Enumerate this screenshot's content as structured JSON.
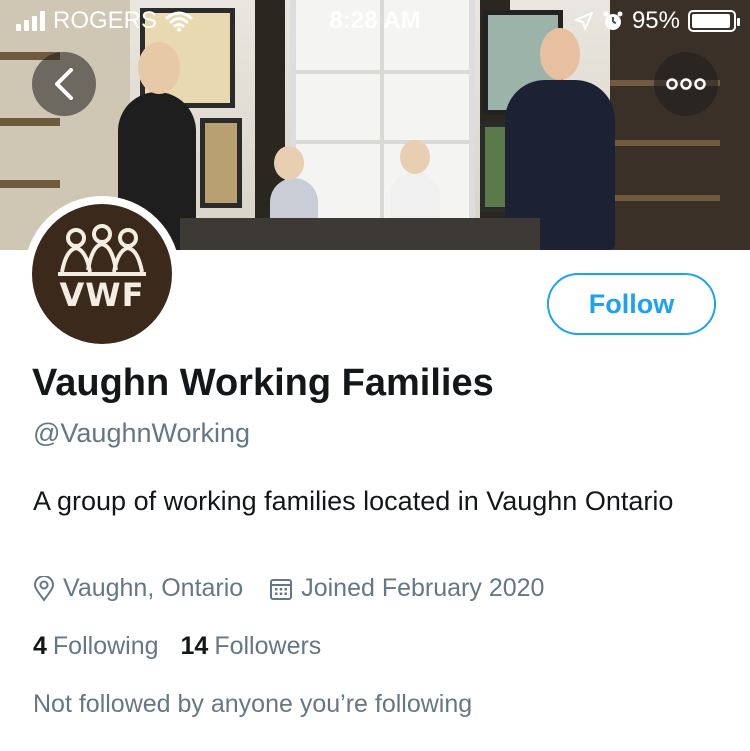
{
  "status_bar": {
    "carrier": "ROGERS",
    "time": "8:28 AM",
    "battery_percent": "95%",
    "battery_level": 0.95
  },
  "banner": {
    "back_icon": "chevron-left-icon",
    "more_icon": "more-horizontal-icon"
  },
  "profile": {
    "avatar_text": "VWF",
    "follow_label": "Follow",
    "display_name": "Vaughn Working Families",
    "handle": "@VaughnWorking",
    "bio": "A group of working families located in Vaughn Ontario",
    "location": "Vaughn, Ontario",
    "joined": "Joined February 2020",
    "following_count": "4",
    "following_label": "Following",
    "followers_count": "14",
    "followers_label": "Followers",
    "not_followed_text": "Not followed by anyone you’re following"
  },
  "colors": {
    "accent": "#1da1f2",
    "secondary_text": "#657786",
    "primary_text": "#14171a"
  }
}
